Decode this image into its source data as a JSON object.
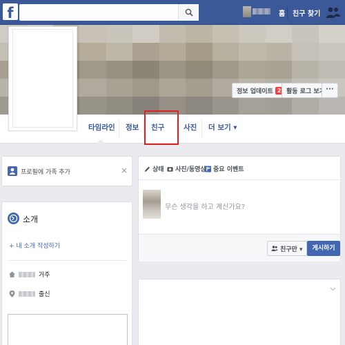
{
  "topbar": {
    "logo": "f",
    "search_placeholder": "",
    "home": "홈",
    "find_friends": "친구 찾기"
  },
  "cover": {
    "update_info": "정보 업데이트",
    "update_badge": "2",
    "activity_log": "활동 로그 보기",
    "more": "···"
  },
  "tabs": [
    {
      "label": "타임라인"
    },
    {
      "label": "정보"
    },
    {
      "label": "친구"
    },
    {
      "label": "사진"
    },
    {
      "label": "더 보기 ▾"
    }
  ],
  "add_family": {
    "label": "프로필에 가족 추가",
    "close": "×"
  },
  "intro": {
    "title": "소개",
    "add_bio": "+ 내 소개 작성하기",
    "lives": "거주",
    "from": "출신"
  },
  "composer": {
    "tab_status": "상태",
    "tab_photo": "사진/동영상",
    "tab_event": "중요 이벤트",
    "placeholder": "무슨 생각을 하고 계신가요?",
    "audience": "친구만 ▾",
    "post": "게시하기"
  },
  "colors": {
    "brand": "#3b5998",
    "link": "#365899",
    "highlight": "#e02121"
  }
}
